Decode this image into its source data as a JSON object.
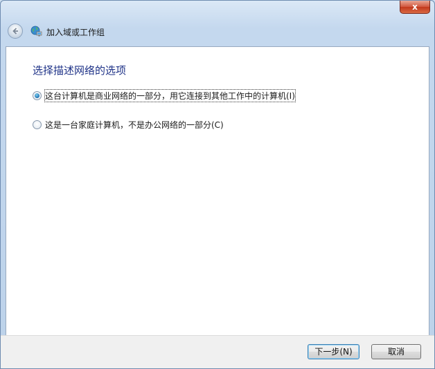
{
  "window": {
    "close_symbol": "x",
    "close_icon": "close-icon"
  },
  "header": {
    "title": "加入域或工作组",
    "back_icon": "back-arrow-icon",
    "app_icon": "network-globe-icon"
  },
  "content": {
    "heading": "选择描述网络的选项",
    "options": [
      {
        "label": "这台计算机是商业网络的一部分，用它连接到其他工作中的计算机(I)",
        "selected": true
      },
      {
        "label": "这是一台家庭计算机，不是办公网络的一部分(C)",
        "selected": false
      }
    ]
  },
  "footer": {
    "next_label": "下一步(N)",
    "cancel_label": "取消"
  },
  "colors": {
    "heading": "#1e3287",
    "close_button": "#c2381d",
    "frame": "#c4d8ee"
  }
}
